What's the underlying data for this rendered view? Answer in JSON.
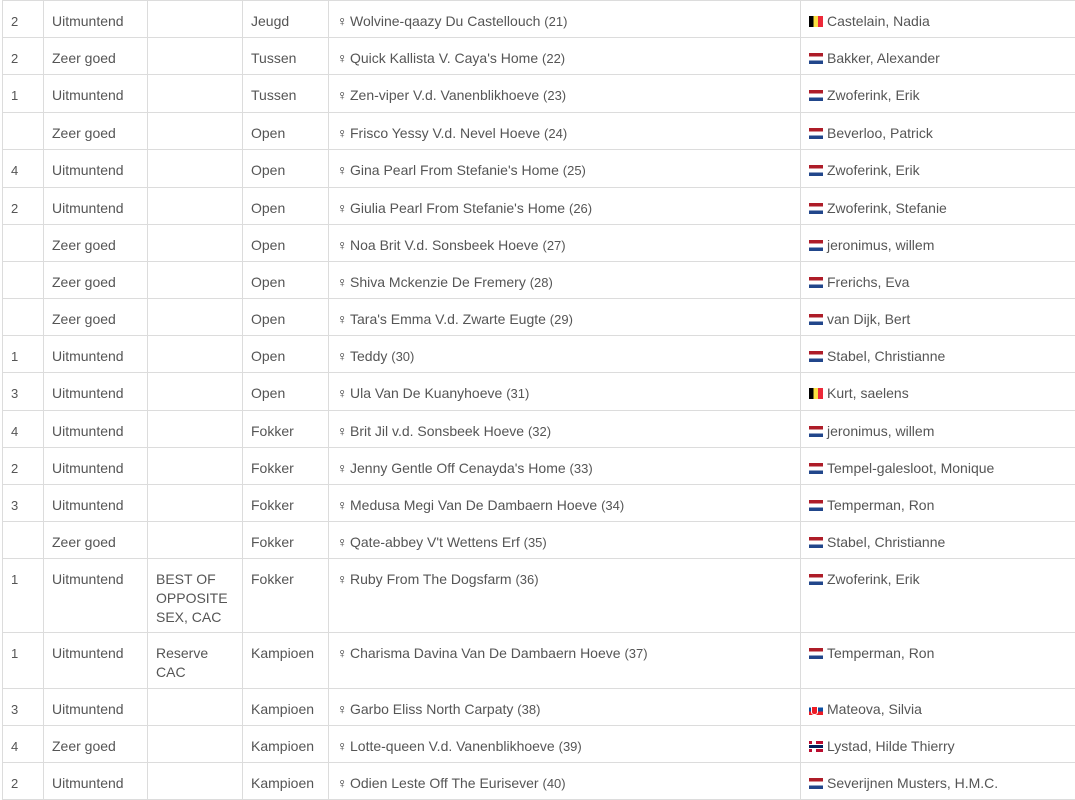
{
  "rows": [
    {
      "place": "2",
      "qual": "Uitmuntend",
      "award": "",
      "klasse": "Jeugd",
      "dog": "Wolvine-qaazy Du Castellouch",
      "num": "(21)",
      "flag": "be",
      "owner": "Castelain, Nadia"
    },
    {
      "place": "2",
      "qual": "Zeer goed",
      "award": "",
      "klasse": "Tussen",
      "dog": "Quick Kallista V. Caya's Home",
      "num": "(22)",
      "flag": "nl",
      "owner": "Bakker, Alexander"
    },
    {
      "place": "1",
      "qual": "Uitmuntend",
      "award": "",
      "klasse": "Tussen",
      "dog": "Zen-viper V.d. Vanenblikhoeve",
      "num": "(23)",
      "flag": "nl",
      "owner": "Zwoferink, Erik"
    },
    {
      "place": "",
      "qual": "Zeer goed",
      "award": "",
      "klasse": "Open",
      "dog": "Frisco Yessy V.d. Nevel Hoeve",
      "num": "(24)",
      "flag": "nl",
      "owner": "Beverloo, Patrick"
    },
    {
      "place": "4",
      "qual": "Uitmuntend",
      "award": "",
      "klasse": "Open",
      "dog": "Gina Pearl From Stefanie's Home",
      "num": "(25)",
      "flag": "nl",
      "owner": "Zwoferink, Erik"
    },
    {
      "place": "2",
      "qual": "Uitmuntend",
      "award": "",
      "klasse": "Open",
      "dog": "Giulia Pearl From Stefanie's Home",
      "num": "(26)",
      "flag": "nl",
      "owner": "Zwoferink, Stefanie"
    },
    {
      "place": "",
      "qual": "Zeer goed",
      "award": "",
      "klasse": "Open",
      "dog": "Noa Brit V.d. Sonsbeek Hoeve",
      "num": "(27)",
      "flag": "nl",
      "owner": "jeronimus, willem"
    },
    {
      "place": "",
      "qual": "Zeer goed",
      "award": "",
      "klasse": "Open",
      "dog": "Shiva Mckenzie De Fremery",
      "num": "(28)",
      "flag": "nl",
      "owner": "Frerichs, Eva"
    },
    {
      "place": "",
      "qual": "Zeer goed",
      "award": "",
      "klasse": "Open",
      "dog": "Tara's Emma V.d. Zwarte Eugte",
      "num": "(29)",
      "flag": "nl",
      "owner": "van Dijk, Bert"
    },
    {
      "place": "1",
      "qual": "Uitmuntend",
      "award": "",
      "klasse": "Open",
      "dog": "Teddy",
      "num": "(30)",
      "flag": "nl",
      "owner": "Stabel, Christianne"
    },
    {
      "place": "3",
      "qual": "Uitmuntend",
      "award": "",
      "klasse": "Open",
      "dog": "Ula Van De Kuanyhoeve",
      "num": "(31)",
      "flag": "be",
      "owner": "Kurt, saelens"
    },
    {
      "place": "4",
      "qual": "Uitmuntend",
      "award": "",
      "klasse": "Fokker",
      "dog": "Brit Jil v.d. Sonsbeek Hoeve",
      "num": "(32)",
      "flag": "nl",
      "owner": "jeronimus, willem"
    },
    {
      "place": "2",
      "qual": "Uitmuntend",
      "award": "",
      "klasse": "Fokker",
      "dog": "Jenny Gentle Off Cenayda's Home",
      "num": "(33)",
      "flag": "nl",
      "owner": "Tempel-galesloot, Monique"
    },
    {
      "place": "3",
      "qual": "Uitmuntend",
      "award": "",
      "klasse": "Fokker",
      "dog": "Medusa Megi Van De Dambaern Hoeve",
      "num": "(34)",
      "flag": "nl",
      "owner": "Temperman, Ron"
    },
    {
      "place": "",
      "qual": "Zeer goed",
      "award": "",
      "klasse": "Fokker",
      "dog": "Qate-abbey V't Wettens Erf",
      "num": "(35)",
      "flag": "nl",
      "owner": "Stabel, Christianne"
    },
    {
      "place": "1",
      "qual": "Uitmuntend",
      "award": "BEST OF OPPOSITE SEX, CAC",
      "klasse": "Fokker",
      "dog": "Ruby From The Dogsfarm",
      "num": "(36)",
      "flag": "nl",
      "owner": "Zwoferink, Erik"
    },
    {
      "place": "1",
      "qual": "Uitmuntend",
      "award": "Reserve CAC",
      "klasse": "Kampioen",
      "dog": "Charisma Davina Van De Dambaern Hoeve",
      "num": "(37)",
      "flag": "nl",
      "owner": "Temperman, Ron"
    },
    {
      "place": "3",
      "qual": "Uitmuntend",
      "award": "",
      "klasse": "Kampioen",
      "dog": "Garbo Eliss North Carpaty",
      "num": "(38)",
      "flag": "sk",
      "owner": "Mateova, Silvia"
    },
    {
      "place": "4",
      "qual": "Zeer goed",
      "award": "",
      "klasse": "Kampioen",
      "dog": "Lotte-queen V.d. Vanenblikhoeve",
      "num": "(39)",
      "flag": "no",
      "owner": "Lystad, Hilde Thierry"
    },
    {
      "place": "2",
      "qual": "Uitmuntend",
      "award": "",
      "klasse": "Kampioen",
      "dog": "Odien Leste Off The Eurisever",
      "num": "(40)",
      "flag": "nl",
      "owner": "Severijnen Musters, H.M.C."
    }
  ],
  "sex_symbol": "♀"
}
